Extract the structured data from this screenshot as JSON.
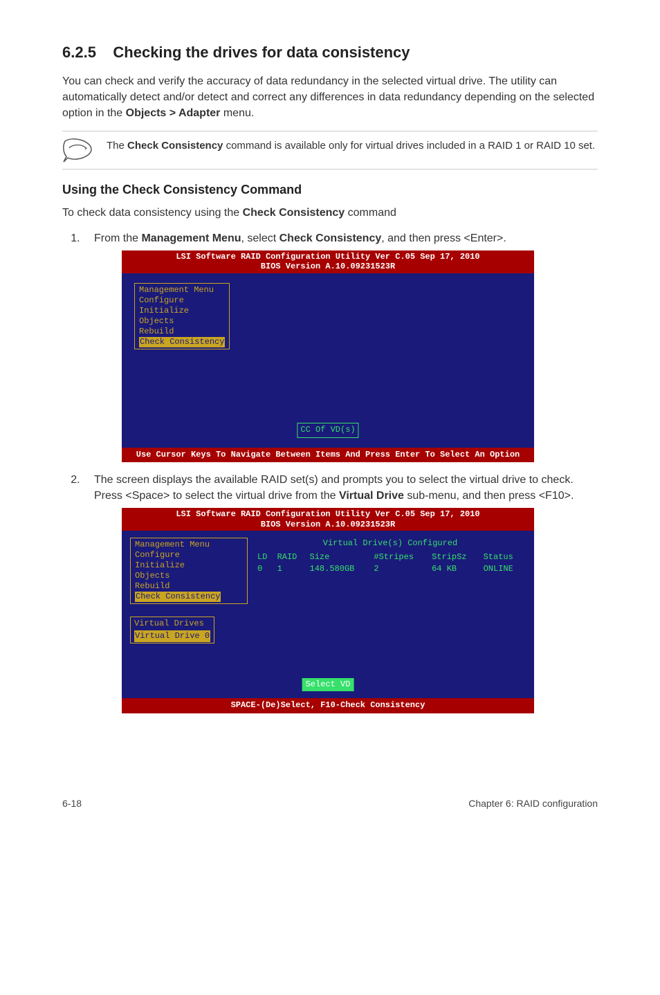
{
  "section": {
    "number": "6.2.5",
    "title": "Checking the drives for data consistency",
    "intro_a": "You can check and verify the accuracy of data redundancy in the selected virtual drive. The utility can automatically detect and/or detect and correct any differences in data redundancy depending on the selected option in the ",
    "intro_bold": "Objects > Adapter",
    "intro_b": " menu.",
    "note_a": "The ",
    "note_bold": "Check Consistency",
    "note_b": " command is available only for virtual drives included in a RAID 1 or RAID 10 set.",
    "subheading": "Using the Check Consistency Command",
    "lead_a": "To check data consistency using the ",
    "lead_bold": "Check Consistency",
    "lead_b": " command"
  },
  "steps": {
    "s1_a": "From the ",
    "s1_b1": "Management Menu",
    "s1_b": ", select ",
    "s1_b2": "Check Consistency",
    "s1_c": ", and then press <Enter>.",
    "s2_a": "The screen displays the available RAID set(s) and prompts you to select the virtual drive to check. Press <Space> to select the virtual drive from the ",
    "s2_bold": "Virtual Drive",
    "s2_b": " sub-menu, and then press <F10>."
  },
  "bios1": {
    "header_line1": "LSI Software RAID Configuration Utility Ver C.05 Sep 17, 2010",
    "header_line2": "BIOS Version   A.10.09231523R",
    "menu_title": "Management Menu",
    "menu_items": {
      "configure": "Configure",
      "initialize": "Initialize",
      "objects": "Objects",
      "rebuild": "Rebuild",
      "check": "Check Consistency"
    },
    "center_box": "CC Of VD(s)",
    "footer": "Use Cursor Keys To Navigate Between Items And Press Enter To Select An Option"
  },
  "bios2": {
    "header_line1": "LSI Software RAID Configuration Utility Ver C.05 Sep 17, 2010",
    "header_line2": "BIOS Version   A.10.09231523R",
    "menu_title": "Management Menu",
    "menu_items": {
      "configure": "Configure",
      "initialize": "Initialize",
      "objects": "Objects",
      "rebuild": "Rebuild",
      "check": "Check Consistency"
    },
    "vd_panel_title": "Virtual Drive(s) Configured",
    "columns": {
      "ld": "LD",
      "raid": "RAID",
      "size": "Size",
      "stripes": "#Stripes",
      "stripsz": "StripSz",
      "status": "Status"
    },
    "row": {
      "ld": "0",
      "raid": "1",
      "size": "148.580GB",
      "stripes": "2",
      "stripsz": "64 KB",
      "status": "ONLINE"
    },
    "vd_box_title": "Virtual Drives",
    "vd_box_item": "Virtual Drive 0",
    "select_vd": "Select VD",
    "footer": "SPACE-(De)Select,    F10-Check Consistency"
  },
  "footer": {
    "left": "6-18",
    "right": "Chapter 6: RAID configuration"
  }
}
